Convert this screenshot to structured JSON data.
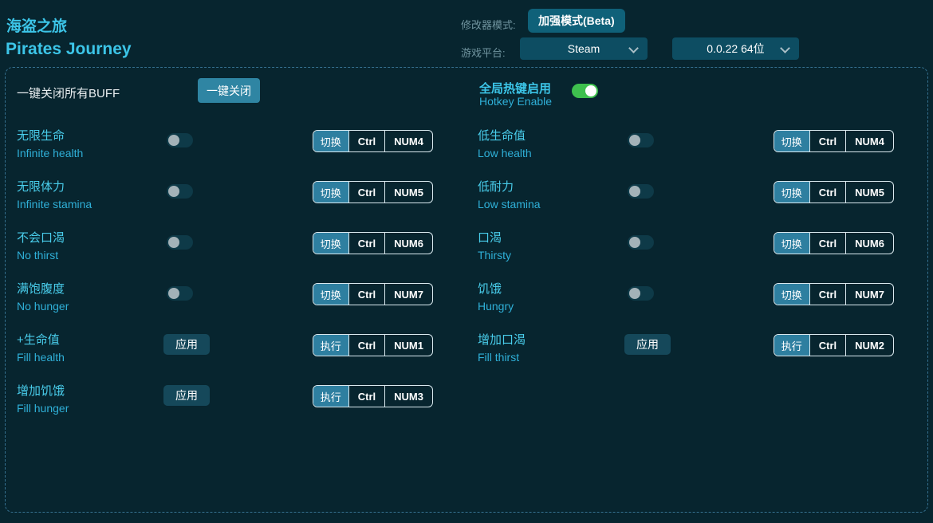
{
  "header": {
    "title_zh": "海盗之旅",
    "title_en": "Pirates Journey",
    "mode_label": "修改器模式:",
    "mode_button": "加强模式(Beta)",
    "platform_label": "游戏平台:",
    "platform_value": "Steam",
    "version_value": "0.0.22 64位"
  },
  "panel": {
    "close_all_label": "一键关闭所有BUFF",
    "close_all_button": "一键关闭",
    "hotkey_enable_zh": "全局热键启用",
    "hotkey_enable_en": "Hotkey Enable",
    "hotkey_enable_state": "on"
  },
  "controls": {
    "apply": "应用"
  },
  "colors": {
    "background": "#07252f",
    "accent_cyan": "#3cc5e8",
    "button_teal": "#2f85a3",
    "toggle_on_green": "#3ec04e",
    "panel_border": "#35708f"
  },
  "cells": [
    {
      "zh": "无限生命",
      "en": "Infinite health",
      "control": "toggle",
      "state": "off",
      "action": "切换",
      "mod": "Ctrl",
      "key": "NUM4"
    },
    {
      "zh": "低生命值",
      "en": "Low health",
      "control": "toggle",
      "state": "off",
      "action": "切换",
      "mod": "Ctrl",
      "key": "NUM4"
    },
    {
      "zh": "无限体力",
      "en": "Infinite stamina",
      "control": "toggle",
      "state": "off",
      "action": "切换",
      "mod": "Ctrl",
      "key": "NUM5"
    },
    {
      "zh": "低耐力",
      "en": "Low stamina",
      "control": "toggle",
      "state": "off",
      "action": "切换",
      "mod": "Ctrl",
      "key": "NUM5"
    },
    {
      "zh": "不会口渴",
      "en": "No thirst",
      "control": "toggle",
      "state": "off",
      "action": "切换",
      "mod": "Ctrl",
      "key": "NUM6"
    },
    {
      "zh": "口渴",
      "en": "Thirsty",
      "control": "toggle",
      "state": "off",
      "action": "切换",
      "mod": "Ctrl",
      "key": "NUM6"
    },
    {
      "zh": "满饱腹度",
      "en": "No hunger",
      "control": "toggle",
      "state": "off",
      "action": "切换",
      "mod": "Ctrl",
      "key": "NUM7"
    },
    {
      "zh": "饥饿",
      "en": "Hungry",
      "control": "toggle",
      "state": "off",
      "action": "切换",
      "mod": "Ctrl",
      "key": "NUM7"
    },
    {
      "zh": "+生命值",
      "en": "Fill health",
      "control": "apply",
      "action": "执行",
      "mod": "Ctrl",
      "key": "NUM1"
    },
    {
      "zh": "增加口渴",
      "en": "Fill thirst",
      "control": "apply",
      "action": "执行",
      "mod": "Ctrl",
      "key": "NUM2"
    },
    {
      "zh": "增加饥饿",
      "en": "Fill hunger",
      "control": "apply",
      "action": "执行",
      "mod": "Ctrl",
      "key": "NUM3"
    }
  ]
}
